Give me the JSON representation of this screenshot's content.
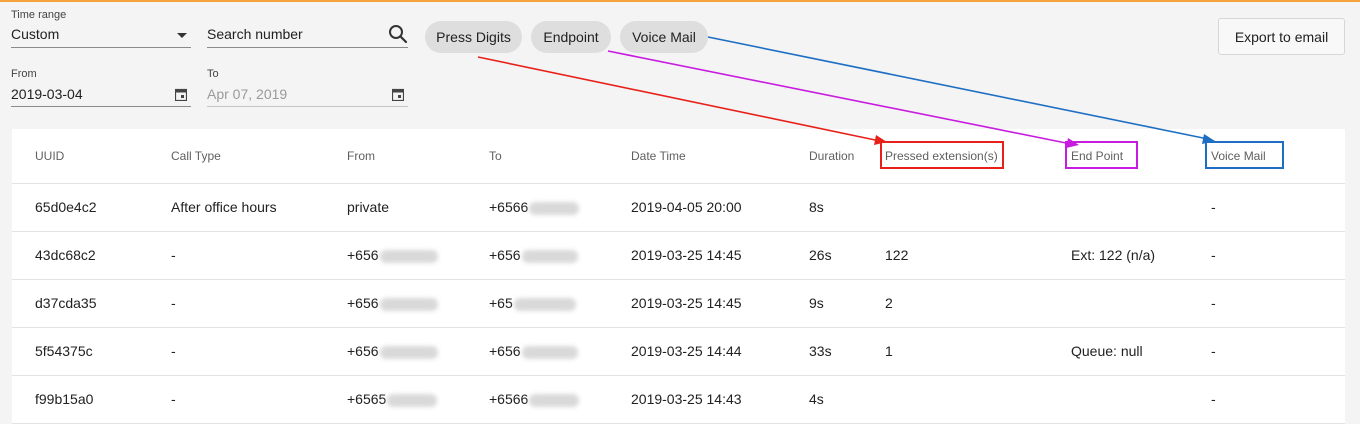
{
  "filters": {
    "time_range_label": "Time range",
    "time_range_value": "Custom",
    "search_placeholder": "Search number",
    "from_label": "From",
    "from_value": "2019-03-04",
    "to_label": "To",
    "to_value": "Apr 07, 2019"
  },
  "chips": [
    "Press Digits",
    "Endpoint",
    "Voice Mail"
  ],
  "export_label": "Export to email",
  "table": {
    "headers": [
      "UUID",
      "Call Type",
      "From",
      "To",
      "Date Time",
      "Duration",
      "Pressed extension(s)",
      "End Point",
      "Voice Mail"
    ],
    "rows": [
      {
        "uuid": "65d0e4c2",
        "call_type": "After office hours",
        "from": "private",
        "to": "+6566",
        "datetime": "2019-04-05 20:00",
        "duration": "8s",
        "pressed": "",
        "endpoint": "",
        "voicemail": "-"
      },
      {
        "uuid": "43dc68c2",
        "call_type": "-",
        "from": "+656",
        "to": "+656",
        "datetime": "2019-03-25 14:45",
        "duration": "26s",
        "pressed": "122",
        "endpoint": "Ext: 122 (n/a)",
        "voicemail": "-"
      },
      {
        "uuid": "d37cda35",
        "call_type": "-",
        "from": "+656",
        "to": "+65",
        "datetime": "2019-03-25 14:45",
        "duration": "9s",
        "pressed": "2",
        "endpoint": "",
        "voicemail": "-"
      },
      {
        "uuid": "5f54375c",
        "call_type": "-",
        "from": "+656",
        "to": "+656",
        "datetime": "2019-03-25 14:44",
        "duration": "33s",
        "pressed": "1",
        "endpoint": "Queue: null",
        "voicemail": "-"
      },
      {
        "uuid": "f99b15a0",
        "call_type": "-",
        "from": "+6565",
        "to": "+6566",
        "datetime": "2019-03-25 14:43",
        "duration": "4s",
        "pressed": "",
        "endpoint": "",
        "voicemail": "-"
      }
    ]
  },
  "annotation_colors": {
    "press_digits": "#e8201a",
    "endpoint": "#c81be0",
    "voice_mail": "#1e6fc4"
  },
  "accent_color": "#f5a23c"
}
